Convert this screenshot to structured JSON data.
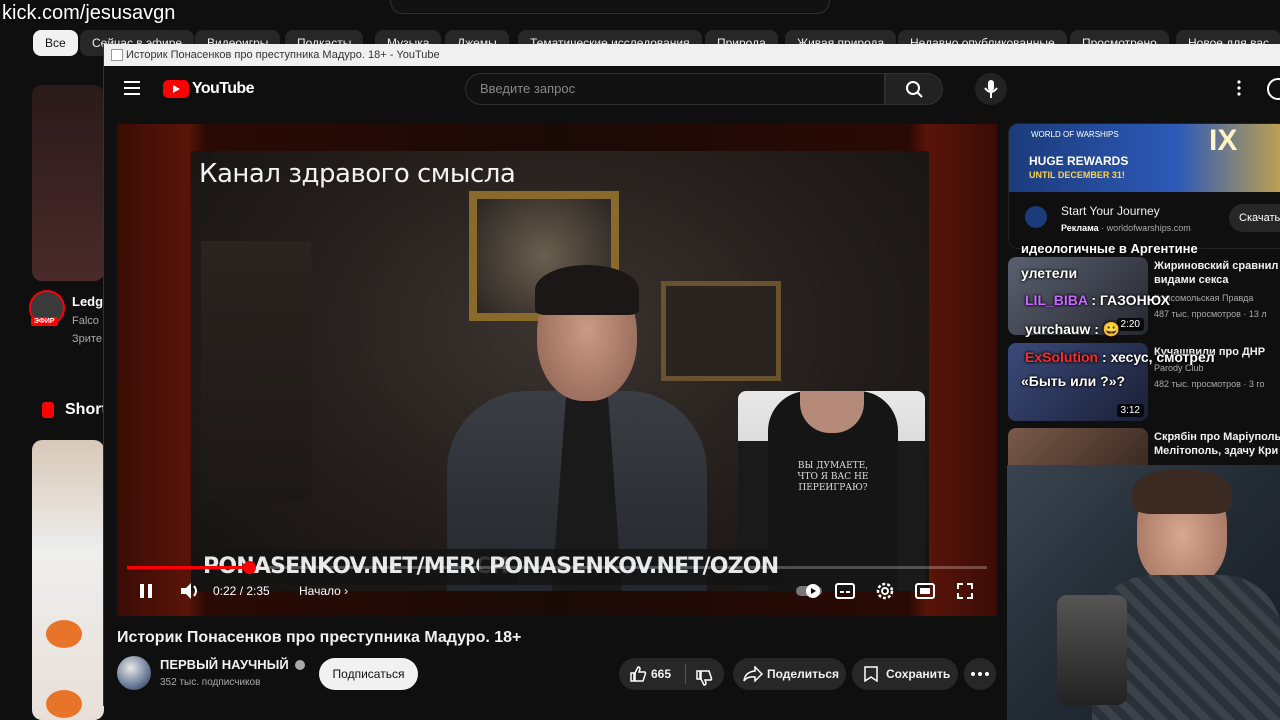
{
  "overlay_url": "kick.com/jesusavgn",
  "bg_page": {
    "chips": [
      "Все",
      "Сейчас в эфире",
      "Видеоигры",
      "Подкасты",
      "Музыка",
      "Джемы",
      "Тематические исследования",
      "Природа",
      "Живая природа",
      "Недавно опубликованные",
      "Просмотрено",
      "Новое для вас"
    ],
    "live_badge": "ЭФИР",
    "live_title": "Ledge",
    "live_channel": "Falco",
    "live_viewers": "Зрите",
    "shorts_label": "Short"
  },
  "window": {
    "title": "Историк Понасенков про преступника Мадуро. 18+ - YouTube"
  },
  "header": {
    "logo_text": "YouTube",
    "search_placeholder": "Введите запрос"
  },
  "player": {
    "overlay_title": "Канал здравого смысла",
    "merch_left": "PONASENKOV.NET/MERCH",
    "merch_right": "PONASENKOV.NET/OZON",
    "hoodie_print": "ВЫ ДУМАЕТЕ, ЧТО Я ВАС НЕ ПЕРЕИГРАЮ?",
    "time": "0:22 / 2:35",
    "chapter": "Начало",
    "progress": 0.142
  },
  "video": {
    "title": "Историк Понасенков про преступника Мадуро. 18+",
    "channel": "ПЕРВЫЙ НАУЧНЫЙ",
    "subscribers": "352 тыс. подписчиков",
    "subscribe_label": "Подписаться",
    "likes": "665",
    "share_label": "Поделиться",
    "save_label": "Сохранить"
  },
  "ad": {
    "brand": "WORLD OF WARSHIPS",
    "banner_line1": "HUGE REWARDS",
    "banner_line2": "UNTIL DECEMBER 31!",
    "banner_numeral": "IX",
    "title": "Start Your Journey",
    "label": "Реклама",
    "domain": "worldofwarships.com",
    "cta": "Скачать"
  },
  "recommendations": [
    {
      "title": "Жириновский сравнил с видами секса",
      "channel": "Комсомольская Правда",
      "meta": "487 тыс. просмотров · 13 л",
      "duration": "2:20"
    },
    {
      "title": "Кучашвили про ДНР",
      "channel": "Parody Club",
      "meta": "482 тыс. просмотров · 3 го",
      "duration": "3:12"
    },
    {
      "title": "Скрябін про Маріуполь Мелітополь, здачу Кри",
      "channel": "",
      "meta": "",
      "duration": ""
    }
  ],
  "chat_overlay": [
    {
      "user": "",
      "text": "идеологичные в Аргентине"
    },
    {
      "user": "",
      "text": "улетели"
    },
    {
      "user": "LIL_BIBA",
      "text": " : ГАЗОНЮХ",
      "color": "#c76bff"
    },
    {
      "user": "yurchauw",
      "text": " : 😀",
      "color": "#ffffff"
    },
    {
      "user": "ExSolution",
      "text": " : хесус, смотрел",
      "color": "#ff2a2a"
    },
    {
      "user": "",
      "text": "«Быть или ?»?"
    }
  ]
}
